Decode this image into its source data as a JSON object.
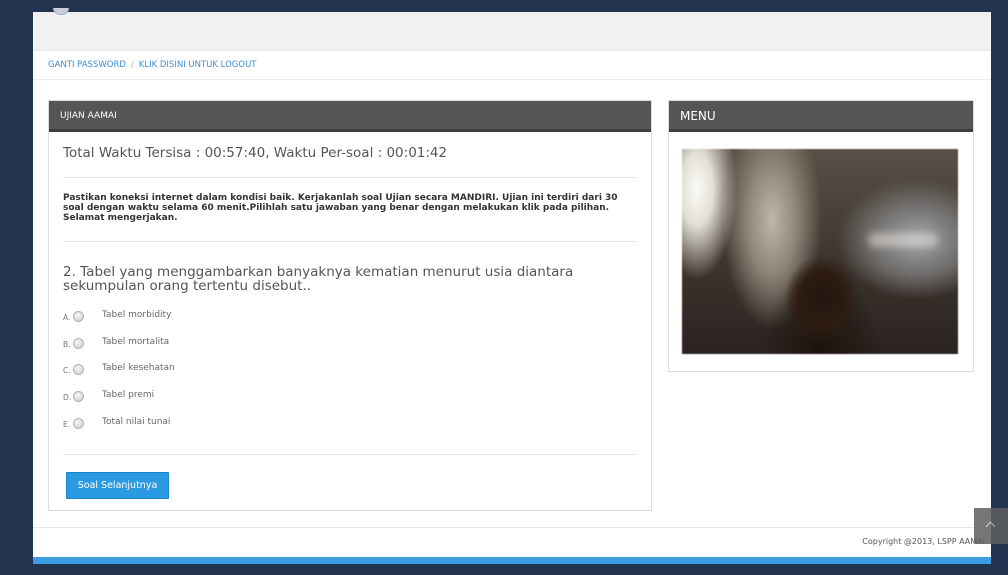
{
  "breadcrumb": {
    "items": [
      "GANTI PASSWORD",
      "KLIK DISINI UNTUK LOGOUT"
    ],
    "separator": "/"
  },
  "exam": {
    "title": "UJIAN AAMAI",
    "timer": "Total Waktu Tersisa : 00:57:40, Waktu Per-soal : 00:01:42",
    "notice": "Pastikan koneksi internet dalam kondisi baik. Kerjakanlah soal Ujian secara MANDIRI. Ujian ini terdiri dari 30 soal dengan waktu selama 60 menit.Pilihlah satu jawaban yang benar dengan melakukan klik pada pilihan. Selamat mengerjakan.",
    "question": "2. Tabel yang menggambarkan banyaknya kematian menurut usia diantara sekumpulan orang tertentu disebut..",
    "options": [
      {
        "letter": "A.",
        "text": "Tabel morbidity"
      },
      {
        "letter": "B.",
        "text": "Tabel mortalita"
      },
      {
        "letter": "C.",
        "text": "Tabel kesehatan"
      },
      {
        "letter": "D.",
        "text": "Tabel premi"
      },
      {
        "letter": "E.",
        "text": "Total nilai tunai"
      }
    ],
    "next_button": "Soal Selanjutnya"
  },
  "menu": {
    "title": "MENU"
  },
  "footer": {
    "copyright": "Copyright @2013, LSPP AAMAI"
  },
  "colors": {
    "background": "#22344f",
    "panel_header": "#555555",
    "link": "#3b8fd4",
    "button": "#2a9ae3",
    "footer_bar": "#3aa0e3"
  }
}
